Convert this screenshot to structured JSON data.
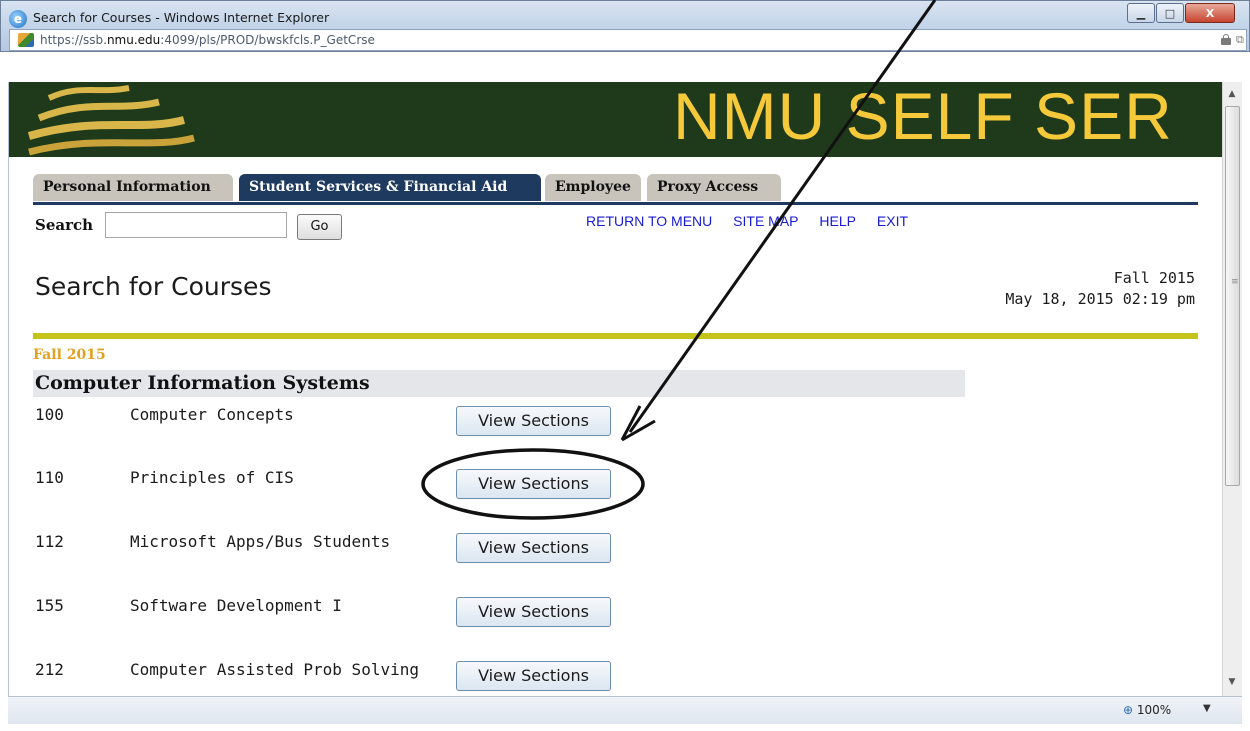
{
  "window": {
    "title": "Search for Courses - Windows Internet Explorer",
    "url_prefix": "https://ssb.",
    "url_domain": "nmu.edu",
    "url_rest": ":4099/pls/PROD/bwskfcls.P_GetCrse",
    "minimize_label": "▁",
    "maximize_label": "□",
    "close_label": "X",
    "zoom": "100%"
  },
  "banner": {
    "title": "NMU SELF SER"
  },
  "tabs": [
    {
      "label": "Personal Information",
      "active": false
    },
    {
      "label": "Student Services & Financial Aid",
      "active": true
    },
    {
      "label": "Employee",
      "active": false
    },
    {
      "label": "Proxy Access",
      "active": false
    }
  ],
  "search": {
    "label": "Search",
    "value": "",
    "go_label": "Go"
  },
  "toplinks": [
    "RETURN TO MENU",
    "SITE MAP",
    "HELP",
    "EXIT"
  ],
  "page": {
    "title": "Search for Courses",
    "term": "Fall 2015",
    "datetime": "May 18, 2015 02:19 pm"
  },
  "term_label": "Fall 2015",
  "subject": "Computer Information Systems",
  "courses": [
    {
      "number": "100",
      "title": "Computer Concepts",
      "button": "View Sections"
    },
    {
      "number": "110",
      "title": "Principles of CIS",
      "button": "View Sections"
    },
    {
      "number": "112",
      "title": "Microsoft Apps/Bus Students",
      "button": "View Sections"
    },
    {
      "number": "155",
      "title": "Software Development I",
      "button": "View Sections"
    },
    {
      "number": "212",
      "title": "Computer Assisted Prob Solving",
      "button": "View Sections"
    }
  ],
  "colors": {
    "banner_bg": "#1e3a1a",
    "banner_text": "#f5c93a",
    "active_tab": "#1e3a5f",
    "rule_yellow": "#c4c319",
    "term_orange": "#e0a020",
    "link_blue": "#1a1ad4"
  }
}
